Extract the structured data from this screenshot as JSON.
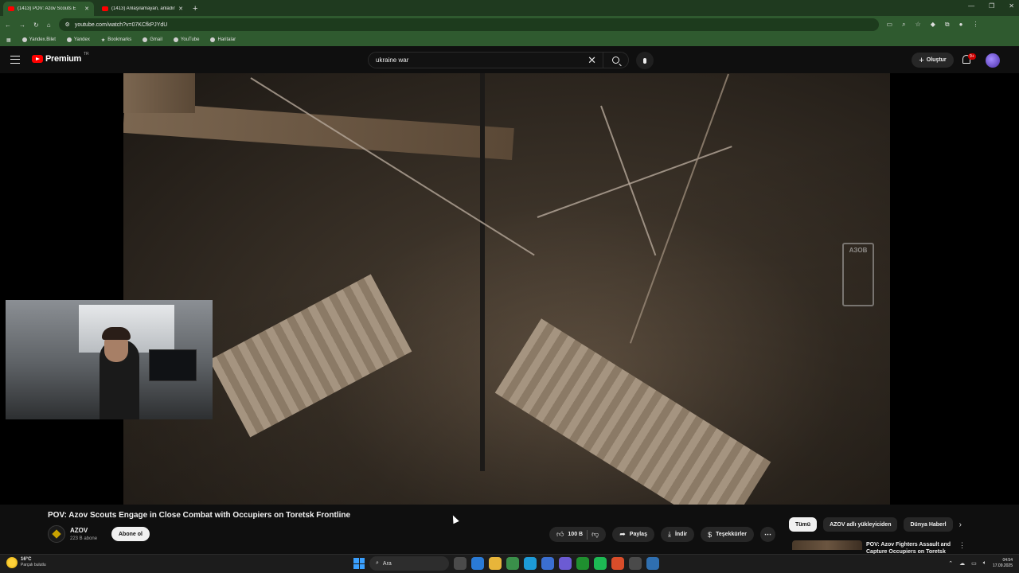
{
  "browser": {
    "tabs": [
      {
        "label": "(1413) POV: Azov Scouts E",
        "active": true
      },
      {
        "label": "(1413) Anlaşılamayan, anladırı",
        "active": false
      }
    ],
    "new_tab": "+",
    "url": "youtube.com/watch?v=07KCfkPJYdU",
    "bookmarks": [
      "Yandex.Bilet",
      "Yandex",
      "Bookmarks",
      "Gmail",
      "YouTube",
      "Haritalar"
    ]
  },
  "youtube": {
    "logo": "Premium",
    "logo_superscript": "TR",
    "search_query": "ukraine war",
    "create_label": "Oluştur",
    "notif_badge": "9+"
  },
  "video": {
    "title": "POV: Azov Scouts Engage in Close Combat with Occupiers on Toretsk Frontline",
    "watermark": "АЗОВ"
  },
  "channel": {
    "name": "AZOV",
    "subscribers": "223 B abone",
    "subscribe_label": "Abone ol"
  },
  "actions": {
    "likes": "100 B",
    "share": "Paylaş",
    "download": "İndir",
    "thanks": "Teşekkürler"
  },
  "chips": [
    "Tümü",
    "AZOV adlı yükleyiciden",
    "Dünya Haberl"
  ],
  "recommended": {
    "title": "POV: Azov Fighters Assault and Capture Occupiers on Toretsk"
  },
  "taskbar": {
    "temp": "16°C",
    "condition": "Parçalı bulutlu",
    "search": "Ara",
    "time": "04:54",
    "date": "17.09.2025"
  },
  "colors": {
    "youtube_red": "#ff0000",
    "browser_frame": "#2f5a2f",
    "background": "#0f0f0f"
  }
}
